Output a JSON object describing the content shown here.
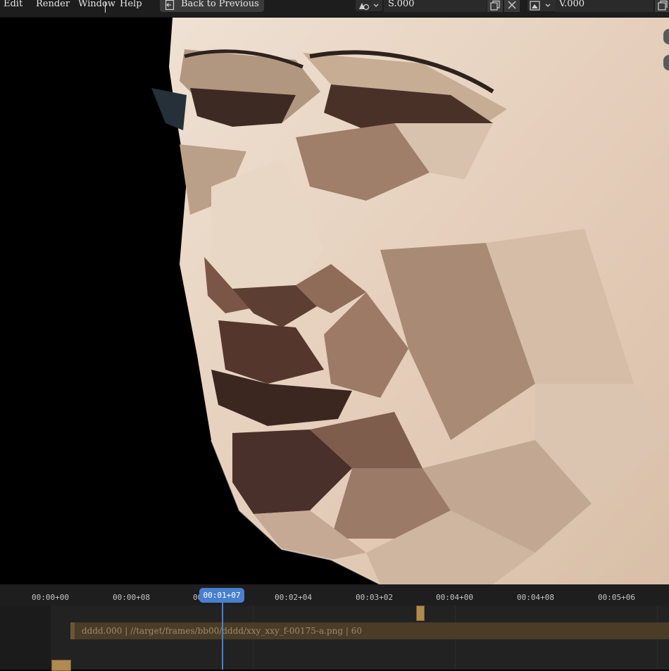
{
  "menu": {
    "items": [
      "Edit",
      "Render",
      "Window",
      "Help"
    ]
  },
  "toolbar": {
    "back_label": "Back to Previous",
    "scale_value": "S.000",
    "view_value": "V.000",
    "icons": [
      "back-icon",
      "overlay-dropdown-icon",
      "copy-icon",
      "close-icon",
      "image-dropdown-icon",
      "new-window-icon"
    ]
  },
  "timeline": {
    "current_time": "00:01+07",
    "ticks": [
      "00:00+00",
      "00:00+08",
      "00:01+07",
      "00:02+04",
      "00:03+02",
      "00:04+00",
      "00:04+08",
      "00:05+06"
    ],
    "strip_label": "dddd.000 | //target/frames/bb00/dddd/xxy_xxy_f-00175-a.png | 60"
  },
  "colors": {
    "accent": "#4a7fd0",
    "strip": "#4a3c27",
    "keyframe": "#b08a50",
    "background": "#1b1b1b"
  }
}
